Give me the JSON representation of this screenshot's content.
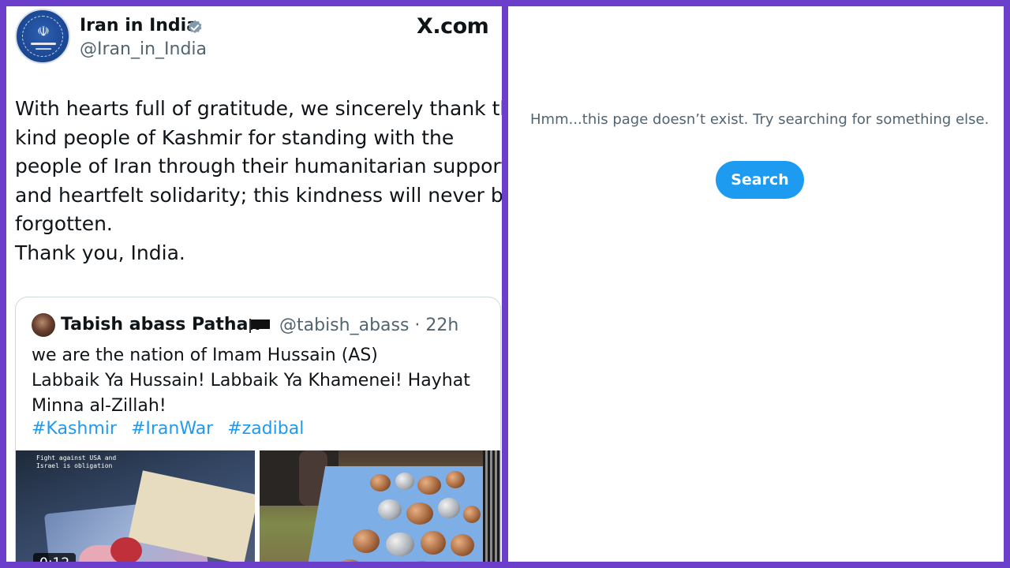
{
  "tweet": {
    "account_name": "Iran in India",
    "handle": "@Iran_in_India",
    "source": "X.com",
    "lines": [
      "With hearts full of gratitude, we sincerely thank the",
      "kind people of Kashmir for standing with the",
      "people of Iran through their humanitarian support",
      "and heartfelt solidarity; this kindness will never be",
      "forgotten.",
      "Thank you, India."
    ]
  },
  "quote": {
    "name": "Tabish abass Pathan",
    "handle_time": "@tabish_abass · 22h",
    "lines": [
      "we are the nation of Imam Hussain (AS)",
      "Labbaik Ya Hussain! Labbaik Ya Khamenei! Hayhat",
      "Minna al-Zillah!"
    ],
    "hashtags": [
      "#Kashmir",
      "#IranWar",
      "#zadibal"
    ],
    "video_overlay": [
      "Fight against USA and",
      "Israel is obligation"
    ],
    "video_duration": "0:12"
  },
  "not_found": {
    "message": "Hmm...this page doesn’t exist. Try searching for something else.",
    "button_label": "Search"
  },
  "colors": {
    "frame": "#6b3fc9",
    "link": "#1d9bf0",
    "muted": "#536471"
  }
}
